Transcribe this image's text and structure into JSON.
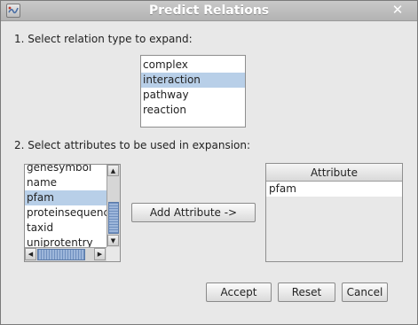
{
  "window": {
    "title": "Predict Relations",
    "close_glyph": "✕"
  },
  "step1": {
    "label": "1. Select relation type to expand:",
    "items": [
      {
        "label": "complex",
        "selected": false
      },
      {
        "label": "interaction",
        "selected": true
      },
      {
        "label": "pathway",
        "selected": false
      },
      {
        "label": "reaction",
        "selected": false
      }
    ]
  },
  "step2": {
    "label": "2. Select attributes to be used in expansion:",
    "items": [
      {
        "label": "genesymbol",
        "selected": false
      },
      {
        "label": "name",
        "selected": false
      },
      {
        "label": "pfam",
        "selected": true
      },
      {
        "label": "proteinsequence",
        "selected": false
      },
      {
        "label": "taxid",
        "selected": false
      },
      {
        "label": "uniprotentry",
        "selected": false
      }
    ]
  },
  "add_attribute_label": "Add Attribute ->",
  "attribute_table": {
    "header": "Attribute",
    "rows": [
      "pfam"
    ]
  },
  "footer": {
    "accept_label": "Accept",
    "reset_label": "Reset",
    "cancel_label": "Cancel"
  },
  "colors": {
    "selection": "#b8cfe8",
    "titlebar": "#b3b3b3",
    "background": "#e8e8e8"
  }
}
